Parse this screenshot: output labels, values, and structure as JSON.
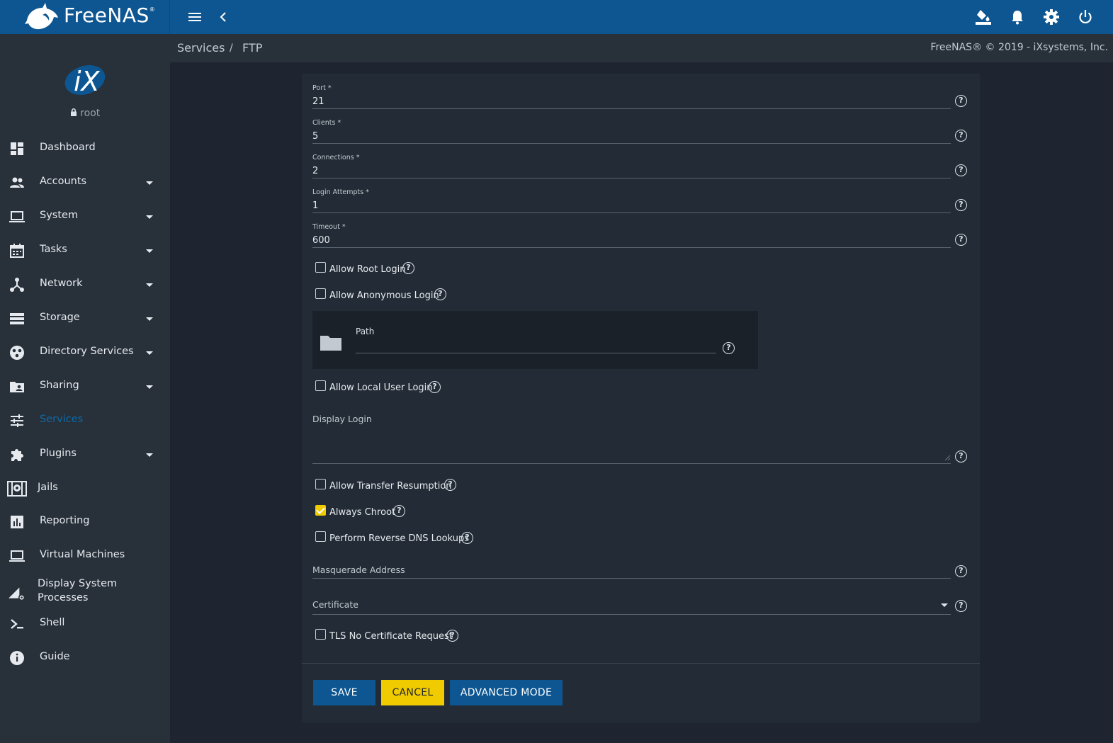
{
  "app": {
    "name": "FreeNAS",
    "trademark": "®"
  },
  "sidebar": {
    "user": "root",
    "items": [
      {
        "label": "Dashboard",
        "icon": "dashboard-icon",
        "expandable": false
      },
      {
        "label": "Accounts",
        "icon": "people-icon",
        "expandable": true
      },
      {
        "label": "System",
        "icon": "laptop-icon",
        "expandable": true
      },
      {
        "label": "Tasks",
        "icon": "calendar-icon",
        "expandable": true
      },
      {
        "label": "Network",
        "icon": "network-icon",
        "expandable": true
      },
      {
        "label": "Storage",
        "icon": "storage-icon",
        "expandable": true
      },
      {
        "label": "Directory Services",
        "icon": "directory-icon",
        "expandable": true
      },
      {
        "label": "Sharing",
        "icon": "folder-shared-icon",
        "expandable": true
      },
      {
        "label": "Services",
        "icon": "tune-icon",
        "expandable": false,
        "active": true
      },
      {
        "label": "Plugins",
        "icon": "puzzle-icon",
        "expandable": true
      },
      {
        "label": "Jails",
        "icon": "jail-icon",
        "expandable": false
      },
      {
        "label": "Reporting",
        "icon": "chart-icon",
        "expandable": false
      },
      {
        "label": "Virtual Machines",
        "icon": "computer-icon",
        "expandable": false
      },
      {
        "label": "Display System Processes",
        "icon": "processes-icon",
        "expandable": false
      },
      {
        "label": "Shell",
        "icon": "shell-icon",
        "expandable": false
      },
      {
        "label": "Guide",
        "icon": "info-icon",
        "expandable": false
      }
    ]
  },
  "breadcrumb": {
    "parent": "Services",
    "separator": "/",
    "current": "FTP"
  },
  "copyright": "FreeNAS® © 2019 - iXsystems, Inc.",
  "form": {
    "port": {
      "label": "Port *",
      "value": "21"
    },
    "clients": {
      "label": "Clients *",
      "value": "5"
    },
    "connections": {
      "label": "Connections *",
      "value": "2"
    },
    "login_attempts": {
      "label": "Login Attempts *",
      "value": "1"
    },
    "timeout": {
      "label": "Timeout *",
      "value": "600"
    },
    "allow_root_login": {
      "label": "Allow Root Login",
      "checked": false
    },
    "allow_anonymous_login": {
      "label": "Allow Anonymous Login",
      "checked": false
    },
    "path": {
      "label": "Path",
      "value": ""
    },
    "allow_local_user_login": {
      "label": "Allow Local User Login",
      "checked": false
    },
    "display_login": {
      "label": "Display Login",
      "value": ""
    },
    "allow_transfer_resumption": {
      "label": "Allow Transfer Resumption",
      "checked": false
    },
    "always_chroot": {
      "label": "Always Chroot",
      "checked": true
    },
    "reverse_dns": {
      "label": "Perform Reverse DNS Lookups",
      "checked": false
    },
    "masquerade_address": {
      "label": "Masquerade Address",
      "value": ""
    },
    "certificate": {
      "label": "Certificate",
      "value": ""
    },
    "tls_no_cert_request": {
      "label": "TLS No Certificate Request",
      "checked": false
    }
  },
  "buttons": {
    "save": "SAVE",
    "cancel": "CANCEL",
    "advanced": "ADVANCED MODE"
  },
  "colors": {
    "topbar": "#0d5691",
    "sidebar": "#28303a",
    "accent": "#f0cb00",
    "active_nav": "#0d6aa8"
  },
  "help_glyph": "?"
}
